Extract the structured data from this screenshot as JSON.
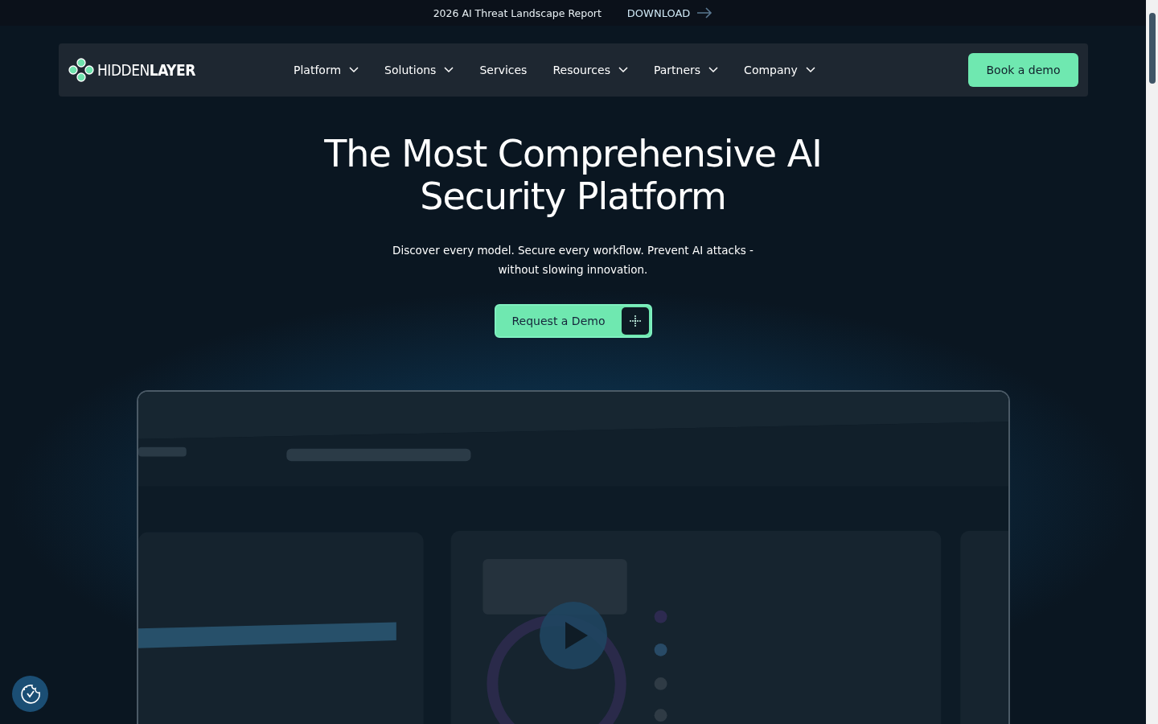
{
  "announcement": {
    "text": "2026 AI Threat Landscape Report",
    "link": "DOWNLOAD"
  },
  "nav": {
    "logo": "HIDDEN**LAYER**",
    "items": [
      {
        "label": "Platform",
        "dropdown": true
      },
      {
        "label": "Solutions",
        "dropdown": true
      },
      {
        "label": "Services",
        "dropdown": false
      },
      {
        "label": "Resources",
        "dropdown": true
      },
      {
        "label": "Partners",
        "dropdown": true
      },
      {
        "label": "Company",
        "dropdown": true
      }
    ],
    "cta": "Book a demo"
  },
  "hero": {
    "title": "The Most Comprehensive AI Security Platform",
    "subtitle": "Discover every model. Secure every workflow. Prevent AI attacks - without slowing innovation.",
    "button": "Request a Demo"
  }
}
